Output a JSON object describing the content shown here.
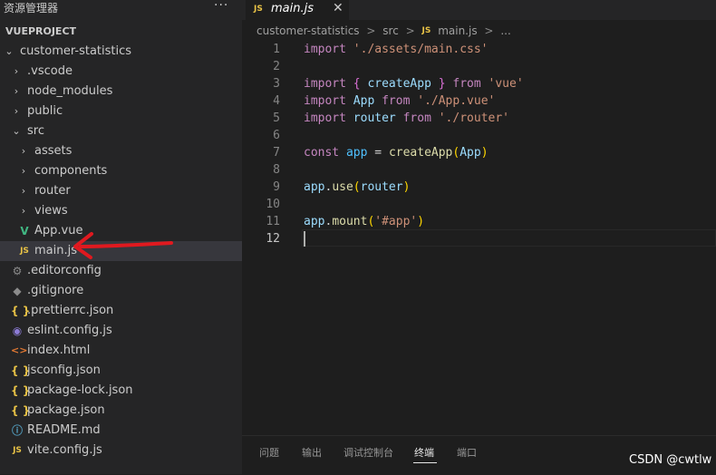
{
  "explorer": {
    "title": "资源管理器",
    "more": "···",
    "project": "VUEPROJECT",
    "tree": [
      {
        "label": "customer-statistics",
        "icon": "chevron-down-icon",
        "kind": "folder-open",
        "indent": 0
      },
      {
        "label": ".vscode",
        "icon": "chevron-right-icon",
        "kind": "folder",
        "indent": 1
      },
      {
        "label": "node_modules",
        "icon": "chevron-right-icon",
        "kind": "folder",
        "indent": 1
      },
      {
        "label": "public",
        "icon": "chevron-right-icon",
        "kind": "folder",
        "indent": 1
      },
      {
        "label": "src",
        "icon": "chevron-down-icon",
        "kind": "folder-open",
        "indent": 1
      },
      {
        "label": "assets",
        "icon": "chevron-right-icon",
        "kind": "folder",
        "indent": 2
      },
      {
        "label": "components",
        "icon": "chevron-right-icon",
        "kind": "folder",
        "indent": 2
      },
      {
        "label": "router",
        "icon": "chevron-right-icon",
        "kind": "folder",
        "indent": 2
      },
      {
        "label": "views",
        "icon": "chevron-right-icon",
        "kind": "folder",
        "indent": 2
      },
      {
        "label": "App.vue",
        "icon": "vue-file-icon",
        "kind": "file",
        "indent": 2
      },
      {
        "label": "main.js",
        "icon": "js-file-icon",
        "kind": "file",
        "indent": 2,
        "selected": true
      },
      {
        "label": ".editorconfig",
        "icon": "gear-icon",
        "kind": "file",
        "indent": 1
      },
      {
        "label": ".gitignore",
        "icon": "git-icon",
        "kind": "file",
        "indent": 1
      },
      {
        "label": ".prettierrc.json",
        "icon": "json-file-icon",
        "kind": "file",
        "indent": 1
      },
      {
        "label": "eslint.config.js",
        "icon": "eslint-icon",
        "kind": "file",
        "indent": 1
      },
      {
        "label": "index.html",
        "icon": "html-file-icon",
        "kind": "file",
        "indent": 1
      },
      {
        "label": "jsconfig.json",
        "icon": "json-file-icon",
        "kind": "file",
        "indent": 1
      },
      {
        "label": "package-lock.json",
        "icon": "json-file-icon",
        "kind": "file",
        "indent": 1
      },
      {
        "label": "package.json",
        "icon": "json-file-icon",
        "kind": "file",
        "indent": 1
      },
      {
        "label": "README.md",
        "icon": "info-icon",
        "kind": "file",
        "indent": 1
      },
      {
        "label": "vite.config.js",
        "icon": "js-file-icon",
        "kind": "file",
        "indent": 1
      }
    ]
  },
  "icons": {
    "js_text": "JS",
    "json_text": "{ }",
    "vue_text": "V",
    "html_text": "<>",
    "info_text": "ⓘ",
    "gear_text": "⚙",
    "git_text": "◆",
    "eslint_text": "◉",
    "chevron_right": "›",
    "chevron_down": "⌄"
  },
  "editor": {
    "tab": {
      "label": "main.js",
      "icon": "JS",
      "close": "✕"
    },
    "breadcrumb": [
      "customer-statistics",
      "src",
      "main.js",
      "..."
    ],
    "breadcrumb_sep": ">",
    "active_line": 12,
    "lines": [
      {
        "n": "1",
        "tokens": [
          [
            "kw",
            "import"
          ],
          [
            "id",
            " "
          ],
          [
            "str",
            "'./assets/main.css'"
          ]
        ]
      },
      {
        "n": "2",
        "tokens": []
      },
      {
        "n": "3",
        "tokens": [
          [
            "kw",
            "import"
          ],
          [
            "id",
            " "
          ],
          [
            "brace",
            "{"
          ],
          [
            "id",
            " "
          ],
          [
            "var",
            "createApp"
          ],
          [
            "id",
            " "
          ],
          [
            "brace",
            "}"
          ],
          [
            "id",
            " "
          ],
          [
            "kw",
            "from"
          ],
          [
            "id",
            " "
          ],
          [
            "str",
            "'vue'"
          ]
        ]
      },
      {
        "n": "4",
        "tokens": [
          [
            "kw",
            "import"
          ],
          [
            "id",
            " "
          ],
          [
            "var",
            "App"
          ],
          [
            "id",
            " "
          ],
          [
            "kw",
            "from"
          ],
          [
            "id",
            " "
          ],
          [
            "str",
            "'./App.vue'"
          ]
        ]
      },
      {
        "n": "5",
        "tokens": [
          [
            "kw",
            "import"
          ],
          [
            "id",
            " "
          ],
          [
            "var",
            "router"
          ],
          [
            "id",
            " "
          ],
          [
            "kw",
            "from"
          ],
          [
            "id",
            " "
          ],
          [
            "str",
            "'./router'"
          ]
        ]
      },
      {
        "n": "6",
        "tokens": []
      },
      {
        "n": "7",
        "tokens": [
          [
            "kw",
            "const"
          ],
          [
            "id",
            " "
          ],
          [
            "var2",
            "app"
          ],
          [
            "id",
            " = "
          ],
          [
            "fn",
            "createApp"
          ],
          [
            "paren",
            "("
          ],
          [
            "var",
            "App"
          ],
          [
            "paren",
            ")"
          ]
        ]
      },
      {
        "n": "8",
        "tokens": []
      },
      {
        "n": "9",
        "tokens": [
          [
            "var",
            "app"
          ],
          [
            "id",
            "."
          ],
          [
            "fn",
            "use"
          ],
          [
            "paren",
            "("
          ],
          [
            "var",
            "router"
          ],
          [
            "paren",
            ")"
          ]
        ]
      },
      {
        "n": "10",
        "tokens": []
      },
      {
        "n": "11",
        "tokens": [
          [
            "var",
            "app"
          ],
          [
            "id",
            "."
          ],
          [
            "fn",
            "mount"
          ],
          [
            "paren",
            "("
          ],
          [
            "str",
            "'#app'"
          ],
          [
            "paren",
            ")"
          ]
        ]
      },
      {
        "n": "12",
        "tokens": []
      }
    ]
  },
  "panel": {
    "tabs": [
      "问题",
      "输出",
      "调试控制台",
      "终端",
      "端口"
    ],
    "active_tab": "终端",
    "watermark": "CSDN @cwtlw"
  },
  "colors": {
    "annotation_arrow": "#e0191f",
    "sidebar_bg": "#252526",
    "editor_bg": "#1e1e1e",
    "selection_bg": "#37373d"
  }
}
